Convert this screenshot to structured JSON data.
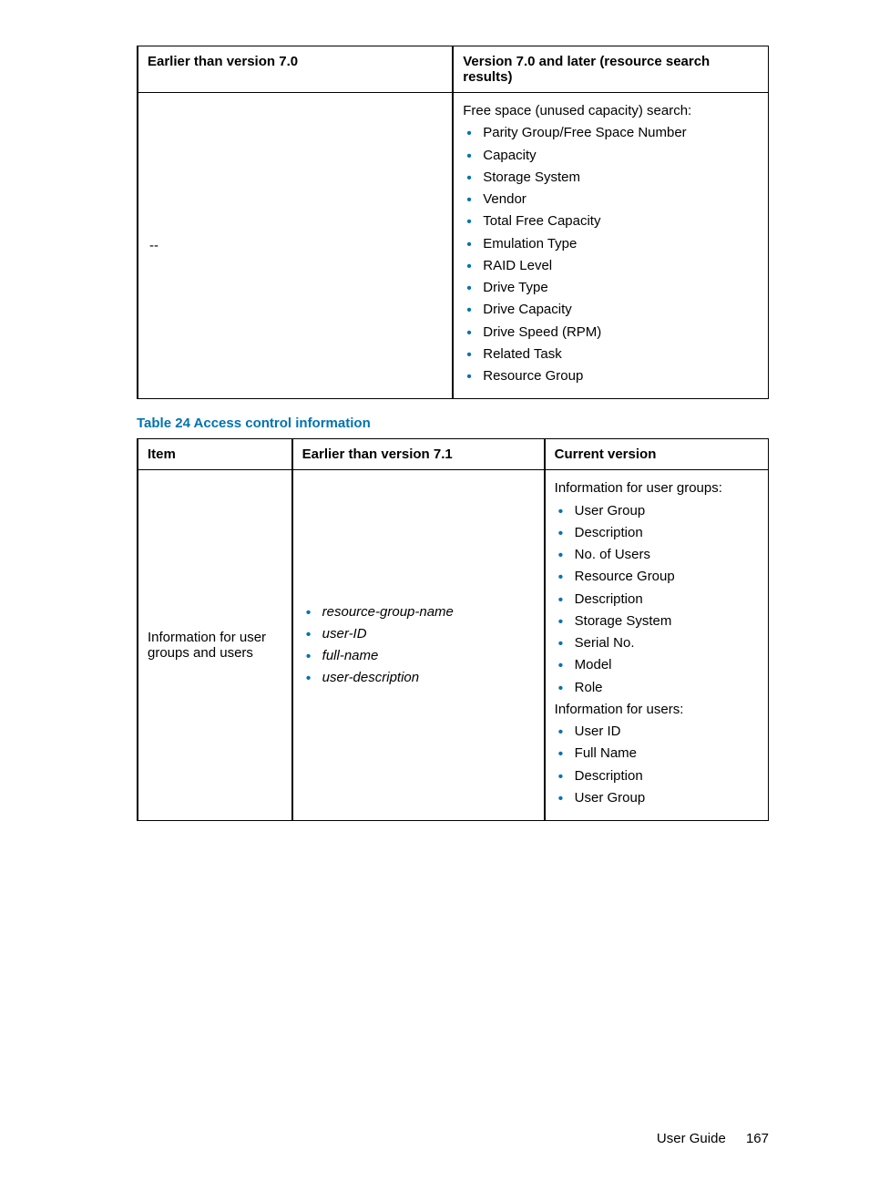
{
  "table1": {
    "headers": {
      "col1": "Earlier than version 7.0",
      "col2": "Version 7.0 and later (resource search results)"
    },
    "row": {
      "col1": "--",
      "col2_intro": "Free space (unused capacity) search:",
      "col2_items": [
        "Parity Group/Free Space Number",
        "Capacity",
        "Storage System",
        "Vendor",
        "Total Free Capacity",
        "Emulation Type",
        "RAID Level",
        "Drive Type",
        "Drive Capacity",
        "Drive Speed (RPM)",
        "Related Task",
        "Resource Group"
      ]
    }
  },
  "caption": "Table 24 Access control information",
  "table2": {
    "headers": {
      "col1": "Item",
      "col2": "Earlier than version 7.1",
      "col3": "Current version"
    },
    "row": {
      "col1": "Information for user groups and users",
      "col2_items": [
        "resource-group-name",
        "user-ID",
        "full-name",
        "user-description"
      ],
      "col3_intro_a": "Information for user groups:",
      "col3_items_a": [
        "User Group",
        "Description",
        "No. of Users",
        "Resource Group",
        "Description",
        "Storage System",
        "Serial No.",
        "Model",
        "Role"
      ],
      "col3_intro_b": "Information for users:",
      "col3_items_b": [
        "User ID",
        "Full Name",
        "Description",
        "User Group"
      ]
    }
  },
  "footer": {
    "label": "User Guide",
    "page": "167"
  }
}
